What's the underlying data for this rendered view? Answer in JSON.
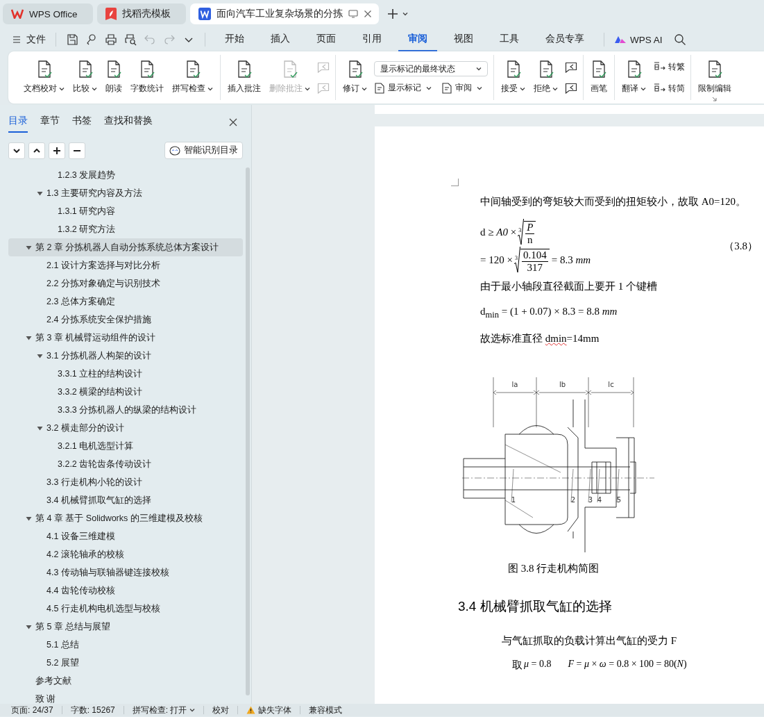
{
  "tabs": [
    {
      "title": "WPS Office",
      "kind": "home",
      "selected": false
    },
    {
      "title": "找稻壳模板",
      "kind": "template",
      "selected": false
    },
    {
      "title": "面向汽车工业复杂场景的分拣",
      "kind": "document",
      "selected": true
    }
  ],
  "menu": {
    "file": "文件",
    "quick_access": [
      {
        "kind": "save",
        "disabled": false
      },
      {
        "kind": "key",
        "disabled": false
      },
      {
        "kind": "print",
        "disabled": false
      },
      {
        "kind": "preview",
        "disabled": false
      },
      {
        "kind": "undo",
        "disabled": true
      },
      {
        "kind": "redo",
        "disabled": true
      },
      {
        "kind": "more",
        "disabled": false
      }
    ],
    "tabs": [
      {
        "label": "开始",
        "selected": false
      },
      {
        "label": "插入",
        "selected": false
      },
      {
        "label": "页面",
        "selected": false
      },
      {
        "label": "引用",
        "selected": false
      },
      {
        "label": "审阅",
        "selected": true
      },
      {
        "label": "视图",
        "selected": false
      },
      {
        "label": "工具",
        "selected": false
      },
      {
        "label": "会员专享",
        "selected": false
      }
    ],
    "ai": "WPS AI"
  },
  "ribbon": {
    "groups": [
      {
        "columns": [
          {
            "kind": "large",
            "label": "文档校对",
            "dropdown": true,
            "disabled": false
          },
          {
            "kind": "large",
            "label": "比较",
            "dropdown": true,
            "disabled": false
          },
          {
            "kind": "large",
            "label": "朗读",
            "dropdown": false,
            "disabled": false
          },
          {
            "kind": "large",
            "label": "字数统计",
            "dropdown": false,
            "disabled": false
          },
          {
            "kind": "large",
            "label": "拼写检查",
            "dropdown": true,
            "disabled": false
          }
        ]
      },
      {
        "columns": [
          {
            "kind": "large",
            "label": "插入批注",
            "dropdown": false,
            "disabled": false
          },
          {
            "kind": "large",
            "label": "删除批注",
            "dropdown": true,
            "disabled": true
          },
          {
            "kind": "stack",
            "items": [
              {
                "disabled": true
              },
              {
                "disabled": true
              }
            ]
          }
        ]
      },
      {
        "columns": [
          {
            "kind": "large",
            "label": "修订",
            "dropdown": true,
            "disabled": false
          },
          {
            "kind": "select",
            "value": "显示标记的最终状态",
            "items": [
              {
                "label": "显示标记",
                "dropdown": true,
                "disabled": false
              },
              {
                "label": "审阅",
                "dropdown": true,
                "disabled": false
              }
            ]
          }
        ]
      },
      {
        "columns": [
          {
            "kind": "large",
            "label": "接受",
            "dropdown": true,
            "disabled": false
          },
          {
            "kind": "large",
            "label": "拒绝",
            "dropdown": true,
            "disabled": false
          },
          {
            "kind": "stack",
            "items": [
              {
                "disabled": false
              },
              {
                "disabled": false
              }
            ]
          }
        ]
      },
      {
        "columns": [
          {
            "kind": "large",
            "label": "画笔",
            "dropdown": false,
            "disabled": false
          }
        ]
      },
      {
        "columns": [
          {
            "kind": "large",
            "label": "翻译",
            "dropdown": true,
            "disabled": false
          },
          {
            "kind": "stack",
            "items": [
              {
                "label": "转繁",
                "disabled": false
              },
              {
                "label": "转简",
                "disabled": false
              }
            ]
          }
        ]
      },
      {
        "columns": [
          {
            "kind": "large",
            "label": "限制编辑",
            "dropdown": false,
            "disabled": false
          }
        ]
      }
    ]
  },
  "sidebar": {
    "tabs": [
      {
        "label": "目录",
        "selected": true
      },
      {
        "label": "章节",
        "selected": false
      },
      {
        "label": "书签",
        "selected": false
      },
      {
        "label": "查找和替换",
        "selected": false
      }
    ],
    "smart_button": "智能识别目录",
    "outline": [
      {
        "children": [
          {
            "children": [
              {
                "label": "1.2.3 发展趋势",
                "selected": false
              }
            ]
          },
          {
            "label": "1.3 主要研究内容及方法",
            "selected": false,
            "expanded": true,
            "children": [
              {
                "label": "1.3.1 研究内容",
                "selected": false
              },
              {
                "label": "1.3.2 研究方法",
                "selected": false
              }
            ]
          }
        ]
      },
      {
        "label": "第 2 章 分拣机器人自动分拣系统总体方案设计",
        "selected": true,
        "expanded": true,
        "children": [
          {
            "label": "2.1 设计方案选择与对比分析",
            "selected": false
          },
          {
            "label": "2.2 分拣对象确定与识别技术",
            "selected": false
          },
          {
            "label": "2.3 总体方案确定",
            "selected": false
          },
          {
            "label": "2.4 分拣系统安全保护措施",
            "selected": false
          }
        ]
      },
      {
        "label": "第 3 章 机械臂运动组件的设计",
        "selected": false,
        "expanded": true,
        "children": [
          {
            "label": "3.1 分拣机器人构架的设计",
            "selected": false,
            "expanded": true,
            "children": [
              {
                "label": "3.3.1 立柱的结构设计",
                "selected": false
              },
              {
                "label": "3.3.2 横梁的结构设计",
                "selected": false
              },
              {
                "label": "3.3.3 分拣机器人的纵梁的结构设计",
                "selected": false
              }
            ]
          },
          {
            "label": "3.2 横走部分的设计",
            "selected": false,
            "expanded": true,
            "children": [
              {
                "label": "3.2.1 电机选型计算",
                "selected": false
              },
              {
                "label": "3.2.2 齿轮齿条传动设计",
                "selected": false
              }
            ]
          },
          {
            "label": "3.3 行走机构小轮的设计",
            "selected": false
          },
          {
            "label": "3.4 机械臂抓取气缸的选择",
            "selected": false
          }
        ]
      },
      {
        "label": "第 4 章 基于 Solidworks 的三维建模及校核",
        "selected": false,
        "expanded": true,
        "children": [
          {
            "label": "4.1 设备三维建模",
            "selected": false
          },
          {
            "label": "4.2 滚轮轴承的校核",
            "selected": false
          },
          {
            "label": "4.3 传动轴与联轴器键连接校核",
            "selected": false
          },
          {
            "label": "4.4 齿轮传动校核",
            "selected": false
          },
          {
            "label": "4.5 行走机构电机选型与校核",
            "selected": false
          }
        ]
      },
      {
        "label": "第 5 章 总结与展望",
        "selected": false,
        "expanded": true,
        "children": [
          {
            "label": "5.1 总结",
            "selected": false
          },
          {
            "label": "5.2 展望",
            "selected": false
          }
        ]
      },
      {
        "label": "参考文献",
        "selected": false
      },
      {
        "label": "致 谢",
        "selected": false
      }
    ]
  },
  "document": {
    "blocks": [
      {
        "kind": "paragraph",
        "text": "中间轴受到的弯矩较大而受到的扭矩较小，故取 A0=120。"
      },
      {
        "kind": "equation",
        "number": "（3.8）",
        "lines": [
          {
            "lhs": "d ≥ *A0* ×",
            "index": "3",
            "numerator": "*P*",
            "denominator": "n"
          },
          {
            "lhs": "= 120 ×",
            "index": "3",
            "numerator": "0.104",
            "denominator": "317",
            "rhs": "= 8.3 *mm*"
          }
        ]
      },
      {
        "kind": "paragraph",
        "text": "由于最小轴段直径截面上要开 1 个键槽"
      },
      {
        "kind": "formula",
        "text": "d$_{min}$ = (1 + 0.07) × 8.3 = 8.8 *mm*"
      },
      {
        "kind": "marked_paragraph",
        "segments": [
          {
            "text": "故选标准直径 ",
            "spell_error": false
          },
          {
            "text": "dmin",
            "spell_error": true
          },
          {
            "text": "=14mm",
            "spell_error": false
          }
        ]
      },
      {
        "kind": "figure",
        "dimension_labels": [
          "la",
          "lb",
          "lc"
        ],
        "part_labels": [
          "1",
          "2",
          "3",
          "4",
          "5"
        ],
        "caption": "图 3.8  行走机构简图"
      },
      {
        "kind": "heading",
        "text": "3.4  机械臂抓取气缸的选择"
      },
      {
        "kind": "centered",
        "text": "与气缸抓取的负载计算出气缸的受力 F"
      },
      {
        "kind": "formula_row",
        "text": "取",
        "formulas": [
          "*μ* = 0.8",
          "*F* = *μ* × *ω* = 0.8 × 100 = 80(*N*)"
        ]
      }
    ]
  },
  "status_bar": {
    "items": [
      {
        "kind": "text",
        "label": "页面: 24/37"
      },
      {
        "kind": "text",
        "label": "字数: 15267"
      },
      {
        "kind": "dropdown",
        "label": "拼写检查: 打开"
      },
      {
        "kind": "text",
        "label": "校对"
      },
      {
        "kind": "warning",
        "label": "缺失字体"
      },
      {
        "kind": "text",
        "label": "兼容模式"
      }
    ]
  }
}
